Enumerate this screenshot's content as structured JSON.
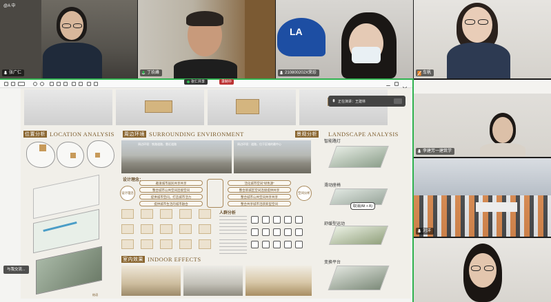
{
  "participants": [
    {
      "name": "张广仁",
      "muted": false
    },
    {
      "name": "丁玖峰",
      "muted": false
    },
    {
      "name": "210800202X荣珍",
      "muted": false
    },
    {
      "name": "车帆",
      "muted": true
    },
    {
      "name": "李建芳一建筑学",
      "muted": false
    },
    {
      "name": "刘洋",
      "muted": false
    },
    {
      "name": "",
      "muted": false
    }
  ],
  "top_left_label": "@A 中",
  "share_bar": {
    "presenter_label": "张仁共享",
    "recording_label": "录制中"
  },
  "poster": {
    "location": {
      "cn": "位置分析",
      "en": "LOCATION ANALYSIS"
    },
    "surrounding": {
      "cn": "周边环境",
      "en": "SURROUNDING ENVIRONMENT"
    },
    "landscape": {
      "cn": "景观分析",
      "en": "LANDSCAPE ANALYSIS"
    },
    "indoor": {
      "cn": "室内效果",
      "en": "INDOOR EFFECTS"
    },
    "design_concept": "设计理念：",
    "concept_left": [
      "邀请城市居民共享共享",
      "整合城市公共空间连接空间",
      "提供城市空间，打造城市活力",
      "提供城市生活的城市融合"
    ],
    "concept_right": [
      "活化城市空间“绿色源”",
      "整合新城区空间连接提供共享",
      "整合城市公共空间共享共享",
      "整合共享城市活跃新型空间"
    ],
    "circle_left": "设计理念",
    "circle_right": "空间分析",
    "people_title": "人群分析",
    "landscape_labels": [
      "智能路灯",
      "滑动座椅",
      "舒缓型运动",
      "变换平台"
    ],
    "bubble": "取消(Alt + A)",
    "photo_caption_1": "周边环境：铁路道路，靠近道路",
    "photo_caption_2": "周边环境：道路，位于区域的最中心",
    "footer_caption": "结语"
  },
  "popup": {
    "text": "正在演讲：王建林"
  },
  "mini_tag": "与我交流..."
}
